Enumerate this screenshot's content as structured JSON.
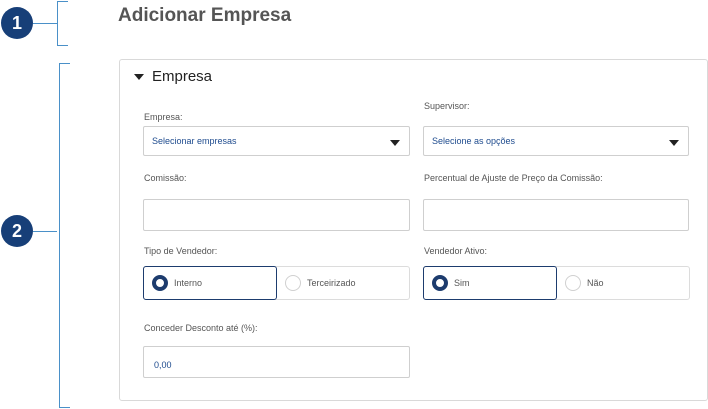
{
  "markers": [
    "1",
    "2"
  ],
  "page_title": "Adicionar Empresa",
  "section": {
    "title": "Empresa"
  },
  "empresa": {
    "label": "Empresa:",
    "value": "Selecionar empresas"
  },
  "supervisor": {
    "label": "Supervisor:",
    "value": "Selecione as opções"
  },
  "comissao": {
    "label": "Comissão:",
    "value": ""
  },
  "percentual": {
    "label": "Percentual de Ajuste de Preço da Comissão:",
    "value": ""
  },
  "tipo_vendedor": {
    "label": "Tipo de Vendedor:",
    "options": [
      "Interno",
      "Terceirizado"
    ],
    "selected": "Interno"
  },
  "vendedor_ativo": {
    "label": "Vendedor Ativo:",
    "options": [
      "Sim",
      "Não"
    ],
    "selected": "Sim"
  },
  "desconto": {
    "label": "Conceder Desconto até (%):",
    "value": "0,00"
  },
  "colors": {
    "marker": "#173f78",
    "bracket": "#4a90c8",
    "accent": "#1d3c6e"
  }
}
